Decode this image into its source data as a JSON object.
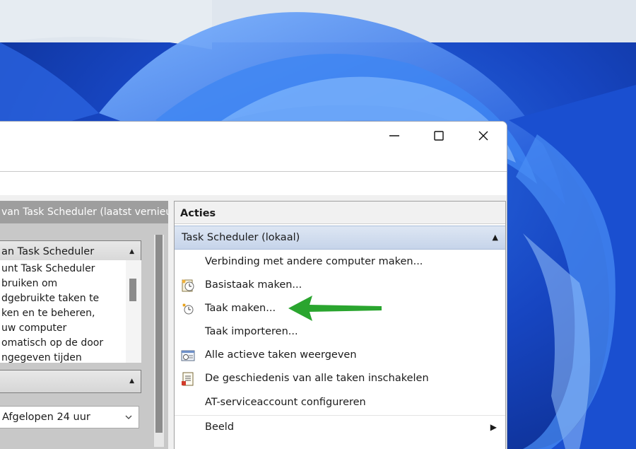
{
  "window": {
    "controls": {
      "minimize": "minimize",
      "maximize": "maximize",
      "close": "close"
    }
  },
  "left_pane": {
    "header": "van Task Scheduler (laatst vernieu",
    "section_title": "an Task Scheduler",
    "description_lines": [
      "unt Task Scheduler",
      "bruiken om",
      "dgebruikte taken te",
      "ken en te beheren,",
      " uw computer",
      "omatisch op de door",
      "ngegeven tijden"
    ],
    "dropdown_value": "Afgelopen 24 uur"
  },
  "actions_pane": {
    "title": "Acties",
    "group": "Task Scheduler (lokaal)",
    "items": [
      {
        "label": "Verbinding met andere computer maken...",
        "icon": "none"
      },
      {
        "label": "Basistaak maken...",
        "icon": "basic-task-icon"
      },
      {
        "label": "Taak maken...",
        "icon": "create-task-icon"
      },
      {
        "label": "Taak importeren...",
        "icon": "none"
      },
      {
        "label": "Alle actieve taken weergeven",
        "icon": "running-tasks-icon"
      },
      {
        "label": "De geschiedenis van alle taken inschakelen",
        "icon": "history-icon"
      },
      {
        "label": "AT-serviceaccount configureren",
        "icon": "none"
      },
      {
        "label": "Beeld",
        "icon": "none",
        "submenu": true
      }
    ]
  },
  "colors": {
    "accent_arrow": "#2aa52f",
    "group_bg": "#c6d4ea",
    "wallpaper": "#1a3fb0"
  }
}
